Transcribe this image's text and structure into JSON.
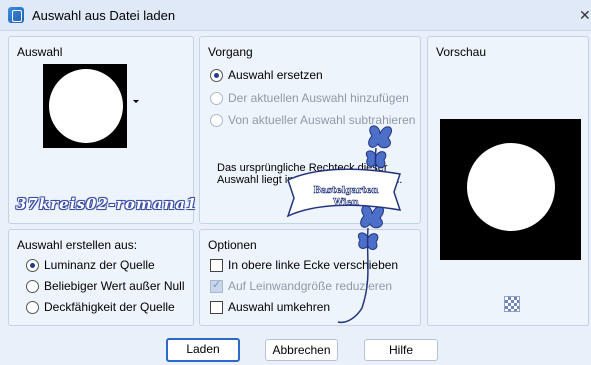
{
  "window": {
    "title": "Auswahl aus Datei laden",
    "close_glyph": "✕"
  },
  "auswahl": {
    "title": "Auswahl"
  },
  "vorgang": {
    "title": "Vorgang",
    "options": [
      {
        "label": "Auswahl ersetzen",
        "selected": true,
        "enabled": true
      },
      {
        "label": "Der aktuellen Auswahl hinzufügen",
        "selected": false,
        "enabled": false
      },
      {
        "label": "Von aktueller Auswahl subtrahieren",
        "selected": false,
        "enabled": false
      }
    ],
    "info": "Das ursprüngliche Rechteck dieser Auswahl liegt innerhalb der Leinwand."
  },
  "vorschau": {
    "title": "Vorschau",
    "zoom_icon": "checker-zoom-icon"
  },
  "erstellen": {
    "title": "Auswahl erstellen aus:",
    "options": [
      {
        "label": "Luminanz der Quelle",
        "selected": true
      },
      {
        "label": "Beliebiger Wert außer Null",
        "selected": false
      },
      {
        "label": "Deckfähigkeit der Quelle",
        "selected": false
      }
    ]
  },
  "optionen": {
    "title": "Optionen",
    "items": [
      {
        "label": "In obere linke Ecke verschieben",
        "checked": false,
        "enabled": true
      },
      {
        "label": "Auf Leinwandgröße reduzieren",
        "checked": true,
        "enabled": false
      },
      {
        "label": "Auswahl umkehren",
        "checked": false,
        "enabled": true
      }
    ]
  },
  "buttons": {
    "load": "Laden",
    "cancel": "Abbrechen",
    "help": "Hilfe"
  },
  "watermark": {
    "text": "37kreis02-romana1"
  },
  "stamp": {
    "line1": "Bastelgarten",
    "line2": "Wien"
  },
  "colors": {
    "accent": "#2d69c7",
    "radio_dot": "#1f3f86",
    "panel": "#eef4fb",
    "background": "#e9f0fa"
  }
}
